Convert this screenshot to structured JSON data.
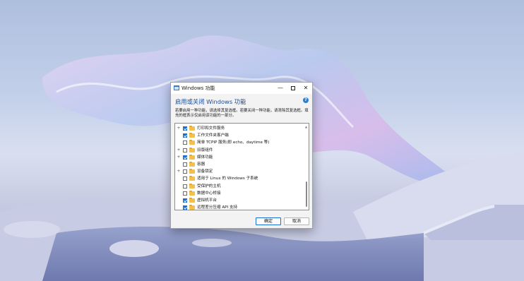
{
  "window": {
    "title": "Windows 功能"
  },
  "titlebar_buttons": {
    "minimize": "—",
    "close": "✕"
  },
  "dialog": {
    "heading": "启用或关闭 Windows 功能",
    "help": "?",
    "description": "若要启用一种功能，请选择其复选框。若要关闭一种功能，请清除其复选框。填充的框表示仅启用该功能的一部分。"
  },
  "features": [
    {
      "label": "打印和文件服务",
      "expandable": true,
      "state": "checked"
    },
    {
      "label": "工作文件夹客户端",
      "expandable": false,
      "state": "checked"
    },
    {
      "label": "简单 TCPIP 服务(即 echo、daytime 等)",
      "expandable": false,
      "state": "unchecked"
    },
    {
      "label": "旧版组件",
      "expandable": true,
      "state": "unchecked"
    },
    {
      "label": "媒体功能",
      "expandable": true,
      "state": "checked"
    },
    {
      "label": "容器",
      "expandable": false,
      "state": "unchecked"
    },
    {
      "label": "设备锁定",
      "expandable": true,
      "state": "unchecked"
    },
    {
      "label": "适用于 Linux 的 Windows 子系统",
      "expandable": false,
      "state": "unchecked"
    },
    {
      "label": "受保护的主机",
      "expandable": false,
      "state": "unchecked"
    },
    {
      "label": "数据中心桥接",
      "expandable": false,
      "state": "unchecked"
    },
    {
      "label": "虚拟机平台",
      "expandable": false,
      "state": "checked"
    },
    {
      "label": "远程差分压缩 API 支持",
      "expandable": false,
      "state": "checked"
    }
  ],
  "buttons": {
    "ok": "确定",
    "cancel": "取消"
  },
  "colors": {
    "accent": "#1c6fd0",
    "heading": "#1a4ea1",
    "highlight": "#e02020",
    "folder": "#f2c04c"
  }
}
